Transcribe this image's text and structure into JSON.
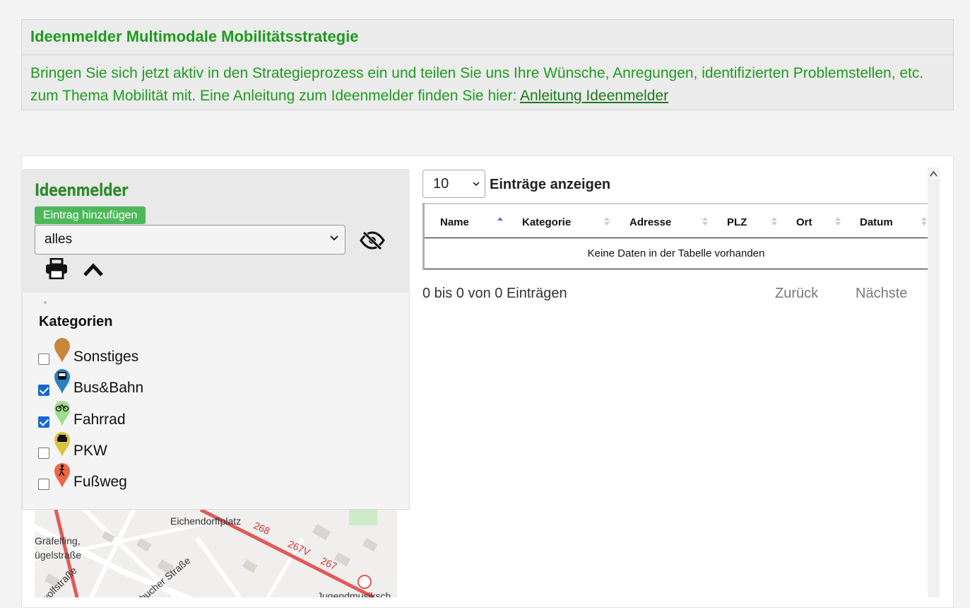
{
  "info": {
    "title": "Ideenmelder Multimodale Mobilitätsstrategie",
    "text_line1": "Bringen Sie sich jetzt aktiv in den Strategieprozess ein und teilen Sie uns Ihre Wünsche, Anregungen, identifizierten Problemstellen, etc.",
    "text_line2": "zum Thema Mobilität mit. Eine Anleitung zum Ideenmelder finden Sie hier: ",
    "link_label": "Anleitung Ideenmelder"
  },
  "control": {
    "title": "Ideenmelder",
    "add_label": "Eintrag hinzufügen",
    "filter_value": "alles"
  },
  "legend": {
    "title": "Kategorien",
    "items": [
      {
        "label": "Sonstiges",
        "checked": false,
        "color": "#c8873a"
      },
      {
        "label": "Bus&Bahn",
        "checked": true,
        "color": "#2a7fc1"
      },
      {
        "label": "Fahrrad",
        "checked": true,
        "color": "#9fdc8e"
      },
      {
        "label": "PKW",
        "checked": false,
        "color": "#d9c43a"
      },
      {
        "label": "Fußweg",
        "checked": false,
        "color": "#ee6645"
      }
    ]
  },
  "map": {
    "labels": [
      "Eichendorffplatz",
      "268",
      "267V",
      "267",
      "Gräfelfing,",
      "ügelstraße",
      "wolfstraße",
      "bucher Straße",
      "Jugendmusiksch"
    ]
  },
  "table": {
    "length_value": "10",
    "length_label": "Einträge anzeigen",
    "columns": [
      "Name",
      "Kategorie",
      "Adresse",
      "PLZ",
      "Ort",
      "Datum"
    ],
    "empty": "Keine Daten in der Tabelle vorhanden",
    "info": "0 bis 0 von 0 Einträgen",
    "prev": "Zurück",
    "next": "Nächste"
  }
}
